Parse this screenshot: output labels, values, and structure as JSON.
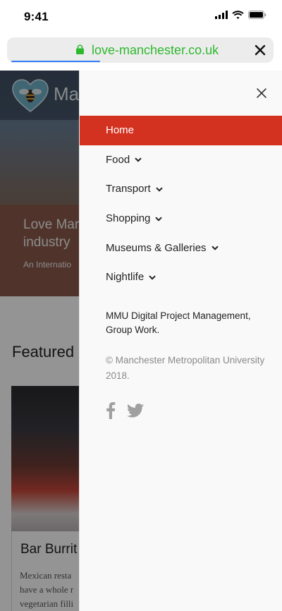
{
  "status_bar": {
    "time": "9:41"
  },
  "browser": {
    "url": "love-manchester.co.uk"
  },
  "background_page": {
    "logo_text": "Ma",
    "hero_title": "Love Mar industry",
    "hero_subtitle": "An Internatio",
    "featured_heading": "Featured",
    "card_title": "Bar Burrit",
    "card_description": "Mexican resta have a whole r vegetarian filli"
  },
  "drawer": {
    "menu": [
      {
        "label": "Home",
        "active": true,
        "has_dropdown": false
      },
      {
        "label": "Food",
        "active": false,
        "has_dropdown": true
      },
      {
        "label": "Transport",
        "active": false,
        "has_dropdown": true
      },
      {
        "label": "Shopping",
        "active": false,
        "has_dropdown": true
      },
      {
        "label": "Museums & Galleries",
        "active": false,
        "has_dropdown": true
      },
      {
        "label": "Nightlife",
        "active": false,
        "has_dropdown": true
      }
    ],
    "note": "MMU Digital Project Management, Group Work.",
    "copyright": "© Manchester Metropolitan University 2018.",
    "social_icons": [
      "facebook-icon",
      "twitter-icon"
    ]
  },
  "colors": {
    "accent": "#d33221",
    "url_text": "#2eb82e",
    "icon_grey": "#a0a0a0"
  }
}
